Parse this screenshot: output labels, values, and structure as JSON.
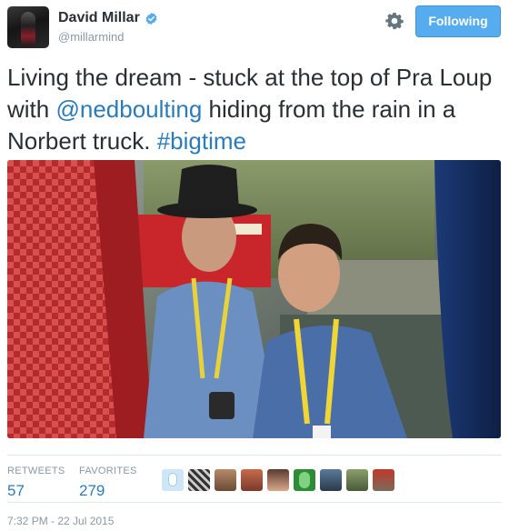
{
  "user": {
    "display_name": "David Millar",
    "handle": "@millarmind",
    "avatar_icon": "profile-avatar",
    "verified_icon": "verified-badge-icon"
  },
  "actions": {
    "settings_icon": "gear-icon",
    "follow_label": "Following"
  },
  "tweet": {
    "text_part1": "Living the dream - stuck at the top of Pra Loup with ",
    "mention": "@nedboulting",
    "text_part2": " hiding from the rain in a Norbert truck. ",
    "hashtag": "#bigtime"
  },
  "stats": {
    "retweets_label": "RETWEETS",
    "retweets_value": "57",
    "favorites_label": "FAVORITES",
    "favorites_value": "279"
  },
  "timestamp": "7:32 PM - 22 Jul 2015",
  "colors": {
    "link": "#2b7bb9",
    "follow_button": "#55acee",
    "muted": "#8899a6"
  }
}
